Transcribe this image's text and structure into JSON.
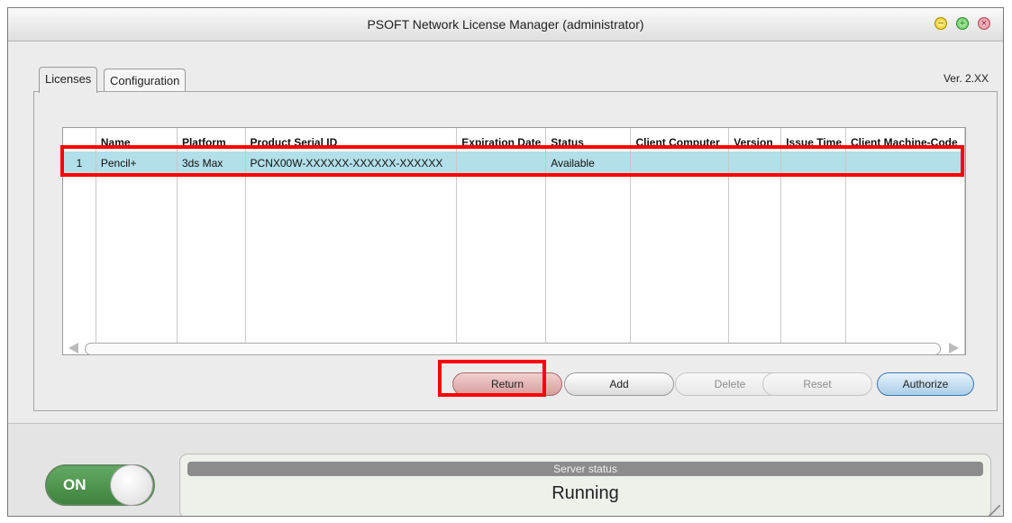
{
  "window": {
    "title": "PSOFT Network License Manager (administrator)",
    "controls": {
      "minimize": "−",
      "maximize": "+",
      "close": "×"
    }
  },
  "tabs": [
    {
      "label": "Licenses",
      "active": true
    },
    {
      "label": "Configuration",
      "active": false
    }
  ],
  "version": "Ver. 2.XX",
  "table": {
    "columns": [
      "",
      "Name",
      "Platform",
      "Product Serial ID",
      "Expiration Date",
      "Status",
      "Client Computer",
      "Version",
      "Issue Time",
      "Client Machine-Code"
    ],
    "rows": [
      {
        "index": "1",
        "name": "Pencil+",
        "platform": "3ds Max",
        "serial": "PCNX00W-XXXXXX-XXXXXX-XXXXXX",
        "expiration": "",
        "status": "Available",
        "client_computer": "",
        "version": "",
        "issue_time": "",
        "client_machine_code": ""
      }
    ]
  },
  "buttons": {
    "return": "Return",
    "add": "Add",
    "delete": "Delete",
    "reset": "Reset",
    "authorize": "Authorize"
  },
  "server": {
    "toggle_label": "ON",
    "status_header": "Server status",
    "status_value": "Running"
  },
  "colors": {
    "selected_row": "#b2dfe9",
    "highlight": "#ff0000",
    "toggle_on": "#4a944a"
  }
}
